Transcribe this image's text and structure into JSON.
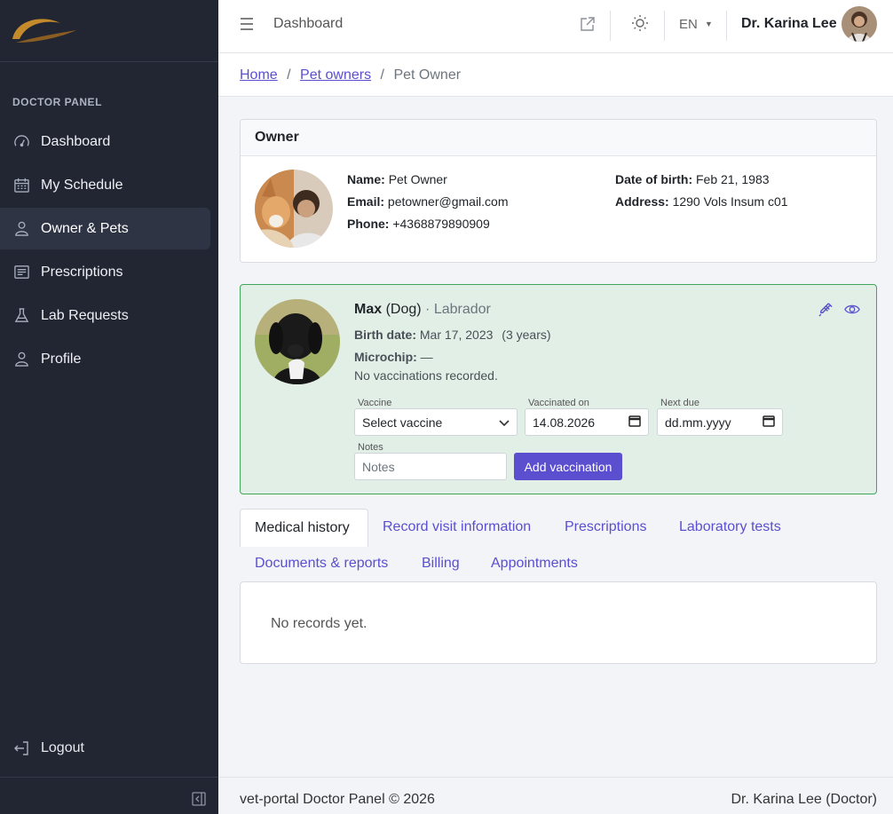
{
  "sidebar": {
    "panel_label": "DOCTOR PANEL",
    "items": [
      {
        "label": "Dashboard",
        "icon": "gauge-icon"
      },
      {
        "label": "My Schedule",
        "icon": "calendar-icon"
      },
      {
        "label": "Owner & Pets",
        "icon": "person-icon",
        "active": true
      },
      {
        "label": "Prescriptions",
        "icon": "document-icon"
      },
      {
        "label": "Lab Requests",
        "icon": "flask-icon"
      },
      {
        "label": "Profile",
        "icon": "person-icon"
      }
    ],
    "logout_label": "Logout"
  },
  "topbar": {
    "title": "Dashboard",
    "language": "EN",
    "user_name": "Dr. Karina Lee"
  },
  "breadcrumb": {
    "home": "Home",
    "pet_owners": "Pet owners",
    "current": "Pet Owner",
    "separator": "/"
  },
  "owner": {
    "heading": "Owner",
    "name_label": "Name:",
    "name": "Pet Owner",
    "email_label": "Email:",
    "email": "petowner@gmail.com",
    "phone_label": "Phone:",
    "phone": "+4368879890909",
    "dob_label": "Date of birth:",
    "dob": "Feb 21, 1983",
    "address_label": "Address:",
    "address": "1290 Vols Insum c01"
  },
  "pet": {
    "name": "Max",
    "species": "(Dog)",
    "breed": "· Labrador",
    "birth_label": "Birth date:",
    "birth_date": "Mar 17, 2023",
    "age": "(3 years)",
    "microchip_label": "Microchip:",
    "microchip": "—",
    "vaccinations_note": "No vaccinations recorded.",
    "form": {
      "vaccine_label": "Vaccine",
      "vaccine_value": "Select vaccine",
      "vaccinated_on_label": "Vaccinated on",
      "vaccinated_on_value": "14.08.2026",
      "next_due_label": "Next due",
      "next_due_value": "dd.mm.yyyy",
      "notes_label": "Notes",
      "notes_placeholder": "Notes",
      "add_button": "Add vaccination"
    }
  },
  "tabs": [
    "Medical history",
    "Record visit information",
    "Prescriptions",
    "Laboratory tests",
    "Documents & reports",
    "Billing",
    "Appointments"
  ],
  "records_empty": "No records yet.",
  "footer": {
    "left": "vet-portal Doctor Panel © 2026",
    "right": "Dr. Karina Lee (Doctor)"
  },
  "colors": {
    "sidebar_bg": "#222633",
    "accent": "#5b4fd0",
    "pet_card_bg": "#e2efe7",
    "pet_card_border": "#3fa65b"
  }
}
